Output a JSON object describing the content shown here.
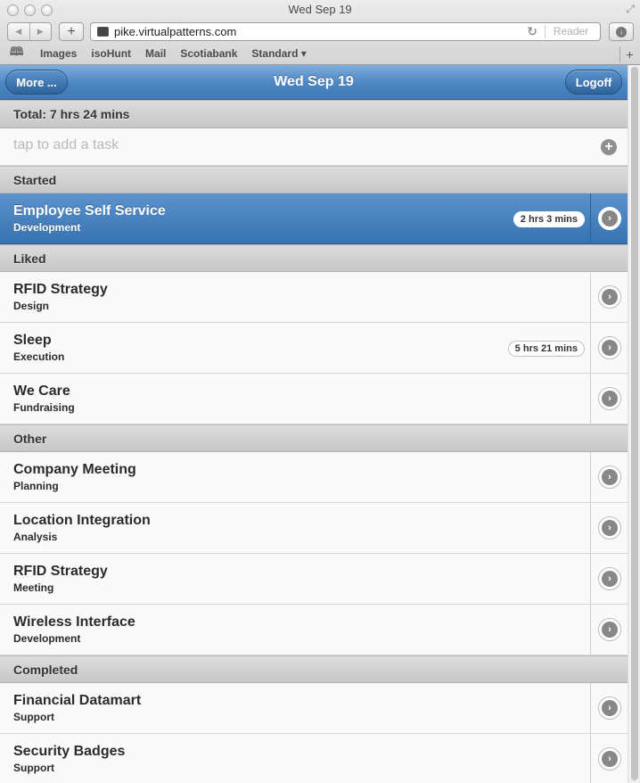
{
  "window": {
    "title": "Wed Sep 19"
  },
  "browser": {
    "url": "pike.virtualpatterns.com",
    "reader_label": "Reader",
    "bookmarks": [
      "Images",
      "isoHunt",
      "Mail",
      "Scotiabank",
      "Standard ▾"
    ]
  },
  "header": {
    "more_label": "More ...",
    "title": "Wed Sep 19",
    "logoff_label": "Logoff"
  },
  "total_label": "Total: 7 hrs 24 mins",
  "add_task": {
    "placeholder": "tap to add a task"
  },
  "sections": {
    "started": {
      "label": "Started",
      "tasks": [
        {
          "title": "Employee Self Service",
          "category": "Development",
          "duration": "2 hrs 3 mins"
        }
      ]
    },
    "liked": {
      "label": "Liked",
      "tasks": [
        {
          "title": "RFID Strategy",
          "category": "Design"
        },
        {
          "title": "Sleep",
          "category": "Execution",
          "duration": "5 hrs 21 mins"
        },
        {
          "title": "We Care",
          "category": "Fundraising"
        }
      ]
    },
    "other": {
      "label": "Other",
      "tasks": [
        {
          "title": "Company Meeting",
          "category": "Planning"
        },
        {
          "title": "Location Integration",
          "category": "Analysis"
        },
        {
          "title": "RFID Strategy",
          "category": "Meeting"
        },
        {
          "title": "Wireless Interface",
          "category": "Development"
        }
      ]
    },
    "completed": {
      "label": "Completed",
      "tasks": [
        {
          "title": "Financial Datamart",
          "category": "Support"
        },
        {
          "title": "Security Badges",
          "category": "Support"
        }
      ]
    }
  },
  "colors": {
    "header_blue": "#4f88c3",
    "active_row_blue": "#3f7ab7",
    "divider_gray": "#d0d0d0"
  }
}
